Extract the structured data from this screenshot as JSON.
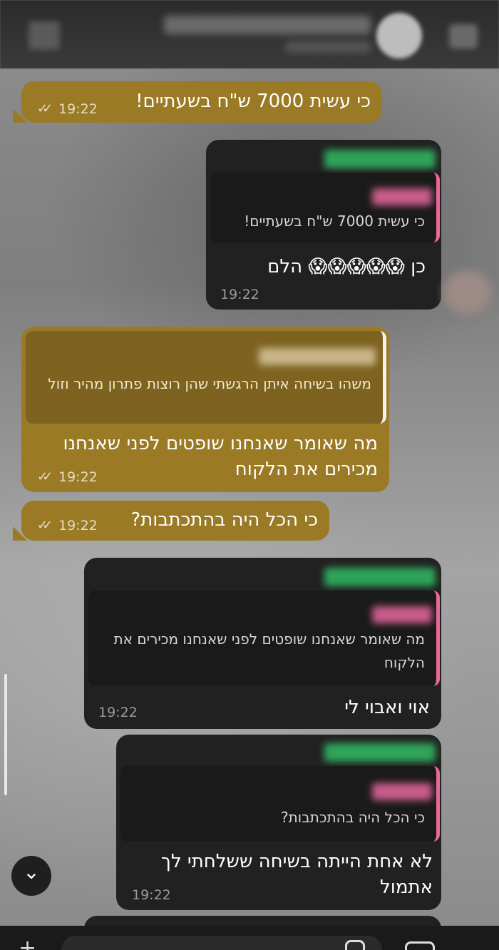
{
  "header": {
    "title": "",
    "subtitle": ""
  },
  "messages": [
    {
      "id": "m1",
      "direction": "outgoing",
      "text": "כי עשית 7000 ש\"ח בשעתיים!",
      "time": "19:22",
      "ticks": "✓✓"
    },
    {
      "id": "m2",
      "direction": "incoming",
      "quote_text": "כי עשית 7000 ש\"ח בשעתיים!",
      "text": "כן 😱😱😱😱😱 הלם",
      "time": "19:22"
    },
    {
      "id": "m3",
      "direction": "outgoing",
      "quote_text": "משהו בשיחה איתן הרגשתי שהן רוצות פתרון מהיר וזול",
      "text": "מה שאומר שאנחנו שופטים לפני שאנחנו מכירים את הלקוח",
      "time": "19:22",
      "ticks": "✓✓"
    },
    {
      "id": "m4",
      "direction": "outgoing",
      "text": "כי הכל היה בהתכתבות?",
      "time": "19:22",
      "ticks": "✓✓"
    },
    {
      "id": "m5",
      "direction": "incoming",
      "quote_text": "מה שאומר שאנחנו שופטים לפני שאנחנו מכירים את הלקוח",
      "text": "אוי ואבוי לי",
      "time": "19:22"
    },
    {
      "id": "m6",
      "direction": "incoming",
      "quote_text": "כי הכל היה בהתכתבות?",
      "text": "לא אחת הייתה בשיחה ששלחתי לך אתמול",
      "time": "19:22"
    }
  ],
  "icons": {
    "scroll_down": "chevron-down-icon",
    "scroll_down_glyph": "⌄",
    "attach": "plus-icon",
    "attach_glyph": "+",
    "sticker": "sticker-icon",
    "camera": "camera-icon"
  },
  "colors": {
    "outgoing_bubble": "#9b7a26",
    "incoming_bubble": "#212121",
    "quote_bar_incoming": "#e9679a",
    "sender_name": "#2fa55a"
  }
}
